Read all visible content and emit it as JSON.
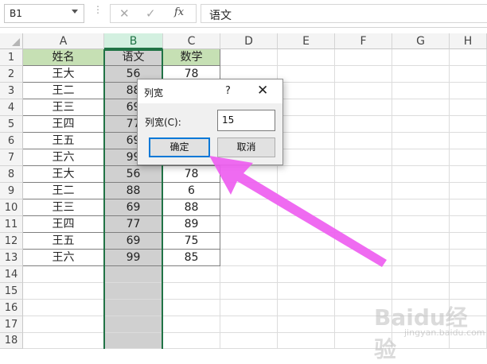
{
  "formula_bar": {
    "name_box": "B1",
    "formula": "语文",
    "cancel_glyph": "✕",
    "enter_glyph": "✓",
    "fx_glyph": "fx",
    "dots": "⋮"
  },
  "columns": [
    "A",
    "B",
    "C",
    "D",
    "E",
    "F",
    "G",
    "H"
  ],
  "rows": [
    "1",
    "2",
    "3",
    "4",
    "5",
    "6",
    "7",
    "8",
    "9",
    "10",
    "11",
    "12",
    "13",
    "14",
    "15",
    "16",
    "17",
    "18"
  ],
  "table": {
    "headers": [
      "姓名",
      "语文",
      "数学"
    ],
    "names": [
      "王大",
      "王二",
      "王三",
      "王四",
      "王五",
      "王六",
      "王大",
      "王二",
      "王三",
      "王四",
      "王五",
      "王六"
    ],
    "chinese": [
      "56",
      "88",
      "69",
      "77",
      "69",
      "99",
      "56",
      "88",
      "69",
      "77",
      "69",
      "99"
    ],
    "math": [
      "78",
      "",
      "",
      "",
      "",
      "",
      "78",
      "6",
      "88",
      "89",
      "75",
      "85"
    ]
  },
  "dialog": {
    "title": "列宽",
    "help": "?",
    "close": "✕",
    "label": "列宽(C):",
    "value": "15",
    "ok_label": "确定",
    "cancel_label": "取消"
  },
  "watermark": {
    "text": "Baidu经验",
    "sub": "jingyan.baidu.com"
  },
  "colors": {
    "header_fill": "#c6e0b4",
    "selection": "#217346",
    "arrow": "#ee5ef0"
  }
}
